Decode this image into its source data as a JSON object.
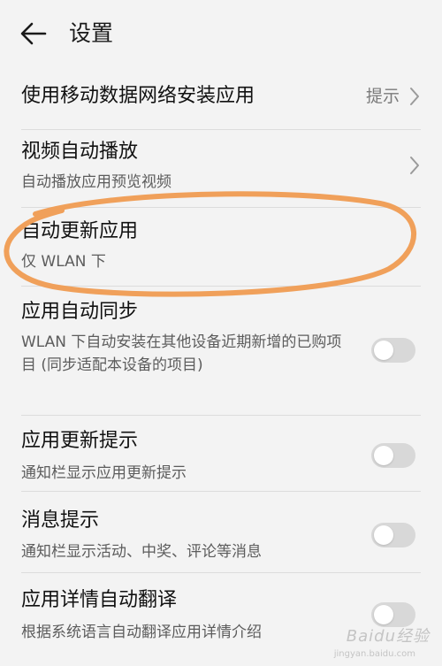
{
  "header": {
    "title": "设置"
  },
  "settings": [
    {
      "title": "使用移动数据网络安装应用",
      "trailing": "提示"
    },
    {
      "title": "视频自动播放",
      "subtitle": "自动播放应用预览视频"
    },
    {
      "title": "自动更新应用",
      "subtitle": "仅 WLAN 下"
    },
    {
      "title": "应用自动同步",
      "subtitle": "WLAN 下自动安装在其他设备近期新增的已购项目 (同步适配本设备的项目)"
    },
    {
      "title": "应用更新提示",
      "subtitle": "通知栏显示应用更新提示"
    },
    {
      "title": "消息提示",
      "subtitle": "通知栏显示活动、中奖、评论等消息"
    },
    {
      "title": "应用详情自动翻译",
      "subtitle": "根据系统语言自动翻译应用详情介绍"
    }
  ],
  "watermark": {
    "text": "Baidu经验",
    "url": "jingyan.baidu.com"
  },
  "colors": {
    "highlight_ellipse": "#f0a05a",
    "toggle_off": "#d8d8d8",
    "background": "#f3f3f3"
  },
  "icons": {
    "back": "arrow-left-icon",
    "chevron": "chevron-right-icon"
  }
}
